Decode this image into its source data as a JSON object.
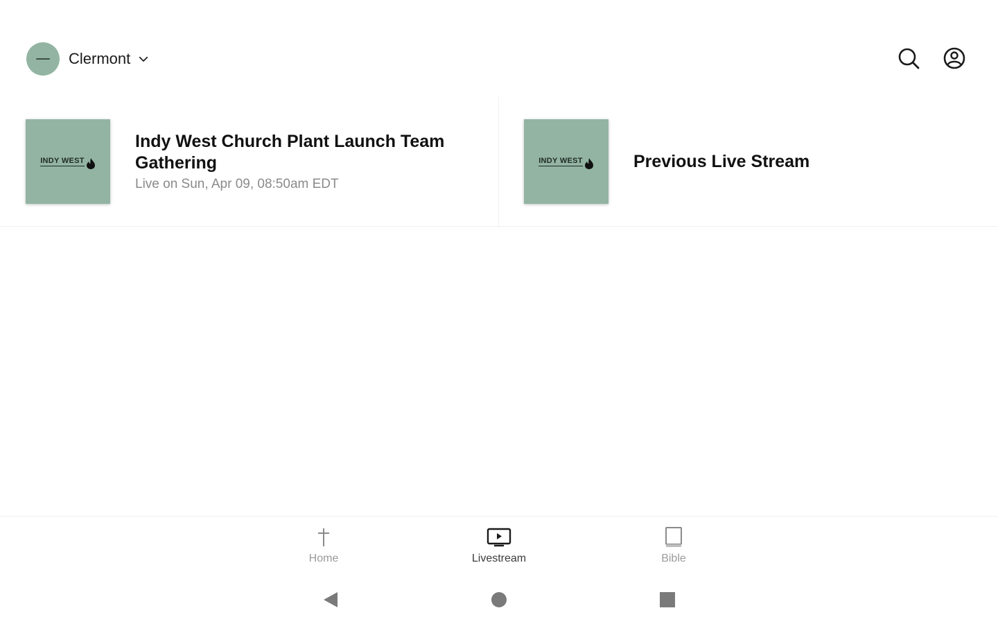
{
  "header": {
    "campus_name": "Clermont"
  },
  "cards": [
    {
      "thumb_logo_text": "INDY WEST",
      "title": "Indy West Church Plant Launch Team Gathering",
      "subtitle": "Live on Sun, Apr 09, 08:50am EDT"
    },
    {
      "thumb_logo_text": "INDY WEST",
      "title": "Previous Live Stream"
    }
  ],
  "bottom_nav": {
    "items": [
      {
        "label": "Home",
        "icon": "cross-icon"
      },
      {
        "label": "Livestream",
        "icon": "tv-play-icon",
        "active": true
      },
      {
        "label": "Bible",
        "icon": "book-icon"
      }
    ]
  },
  "colors": {
    "thumb_bg": "#93b4a3",
    "active_label": "#3b3b3b",
    "inactive_label": "#9a9a9a"
  }
}
